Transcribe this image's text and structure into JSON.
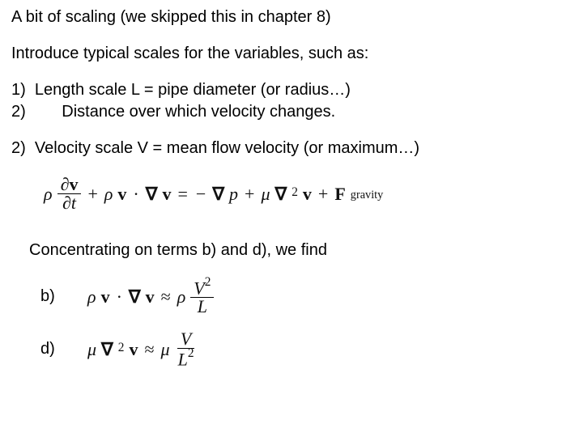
{
  "title": "A bit of scaling (we skipped this in chapter 8)",
  "intro": "Introduce typical scales for the variables, such as:",
  "item1_num": "1)",
  "item1_text": "Length scale L = pipe diameter (or radius…)",
  "item1b_num": "2)",
  "item1b_text": "Distance over which velocity changes.",
  "item2_num": "2)",
  "item2_text": "Velocity scale V = mean flow velocity (or maximum…)",
  "concentrating": "Concentrating on terms b) and d), we find",
  "label_b": "b)",
  "label_d": "d)",
  "sym": {
    "rho": "ρ",
    "mu": "μ",
    "partial": "∂",
    "nabla": "∇",
    "v_bold": "v",
    "t": "t",
    "dot": "·",
    "p": "p",
    "F": "F",
    "gravity": "gravity",
    "plus": "+",
    "minus": "−",
    "eq": "=",
    "approx": "≈",
    "V": "V",
    "L": "L",
    "two": "2"
  }
}
